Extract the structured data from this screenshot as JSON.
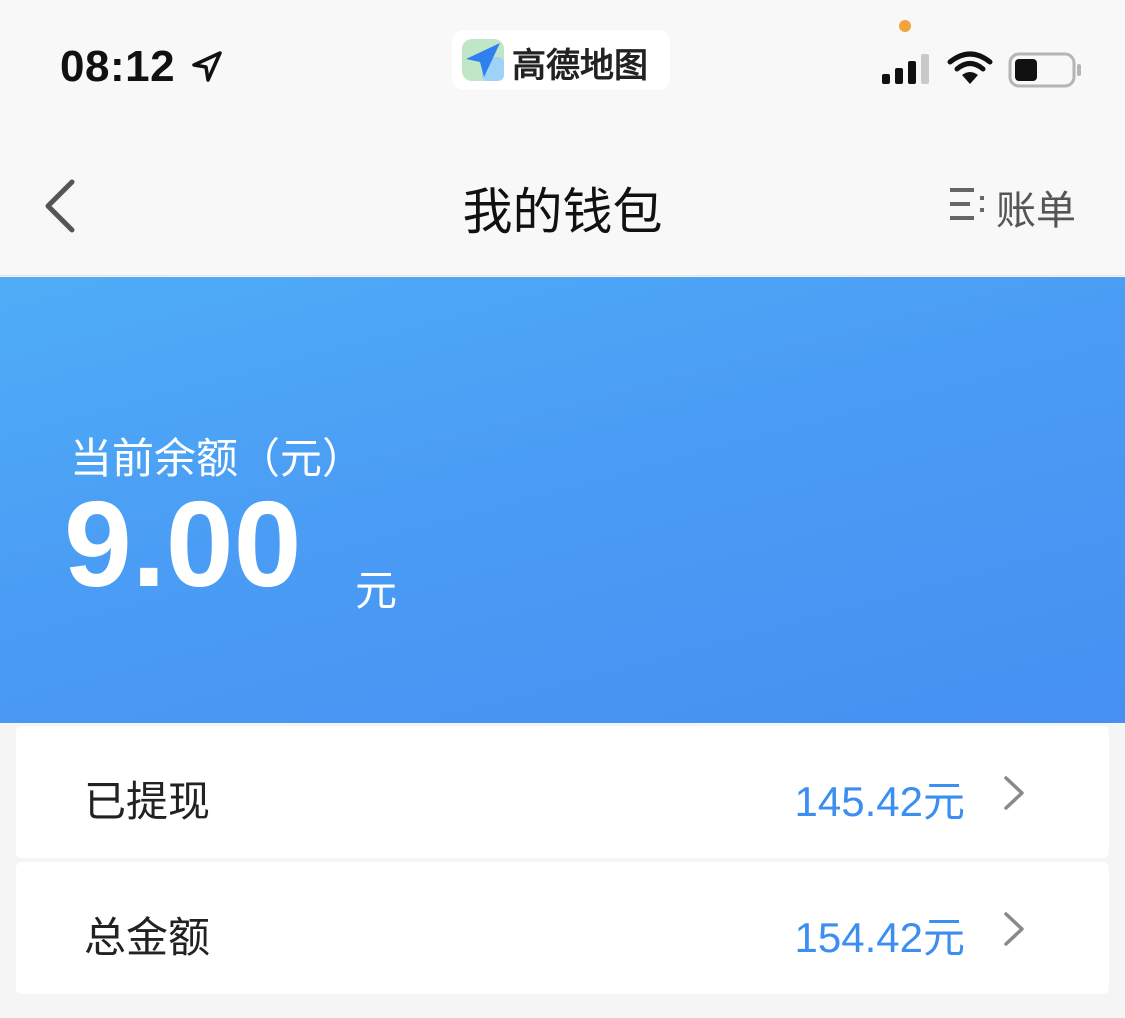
{
  "status_bar": {
    "time": "08:12",
    "app_name": "高德地图",
    "icons": [
      "location-arrow-icon",
      "signal-icon",
      "wifi-icon",
      "battery-icon"
    ]
  },
  "nav": {
    "title": "我的钱包",
    "bill_label": "账单",
    "icons": [
      "back-chevron-icon",
      "list-icon"
    ]
  },
  "balance": {
    "label": "当前余额（元）",
    "amount": "9.00",
    "unit": "元"
  },
  "rows": [
    {
      "label": "已提现",
      "value": "145.42元"
    },
    {
      "label": "总金额",
      "value": "154.42元"
    }
  ],
  "colors": {
    "accent_blue": "#3c8ff0",
    "card_gradient_start": "#4fadf7",
    "card_gradient_end": "#4590f2",
    "status_dot": "#f0a43a"
  }
}
